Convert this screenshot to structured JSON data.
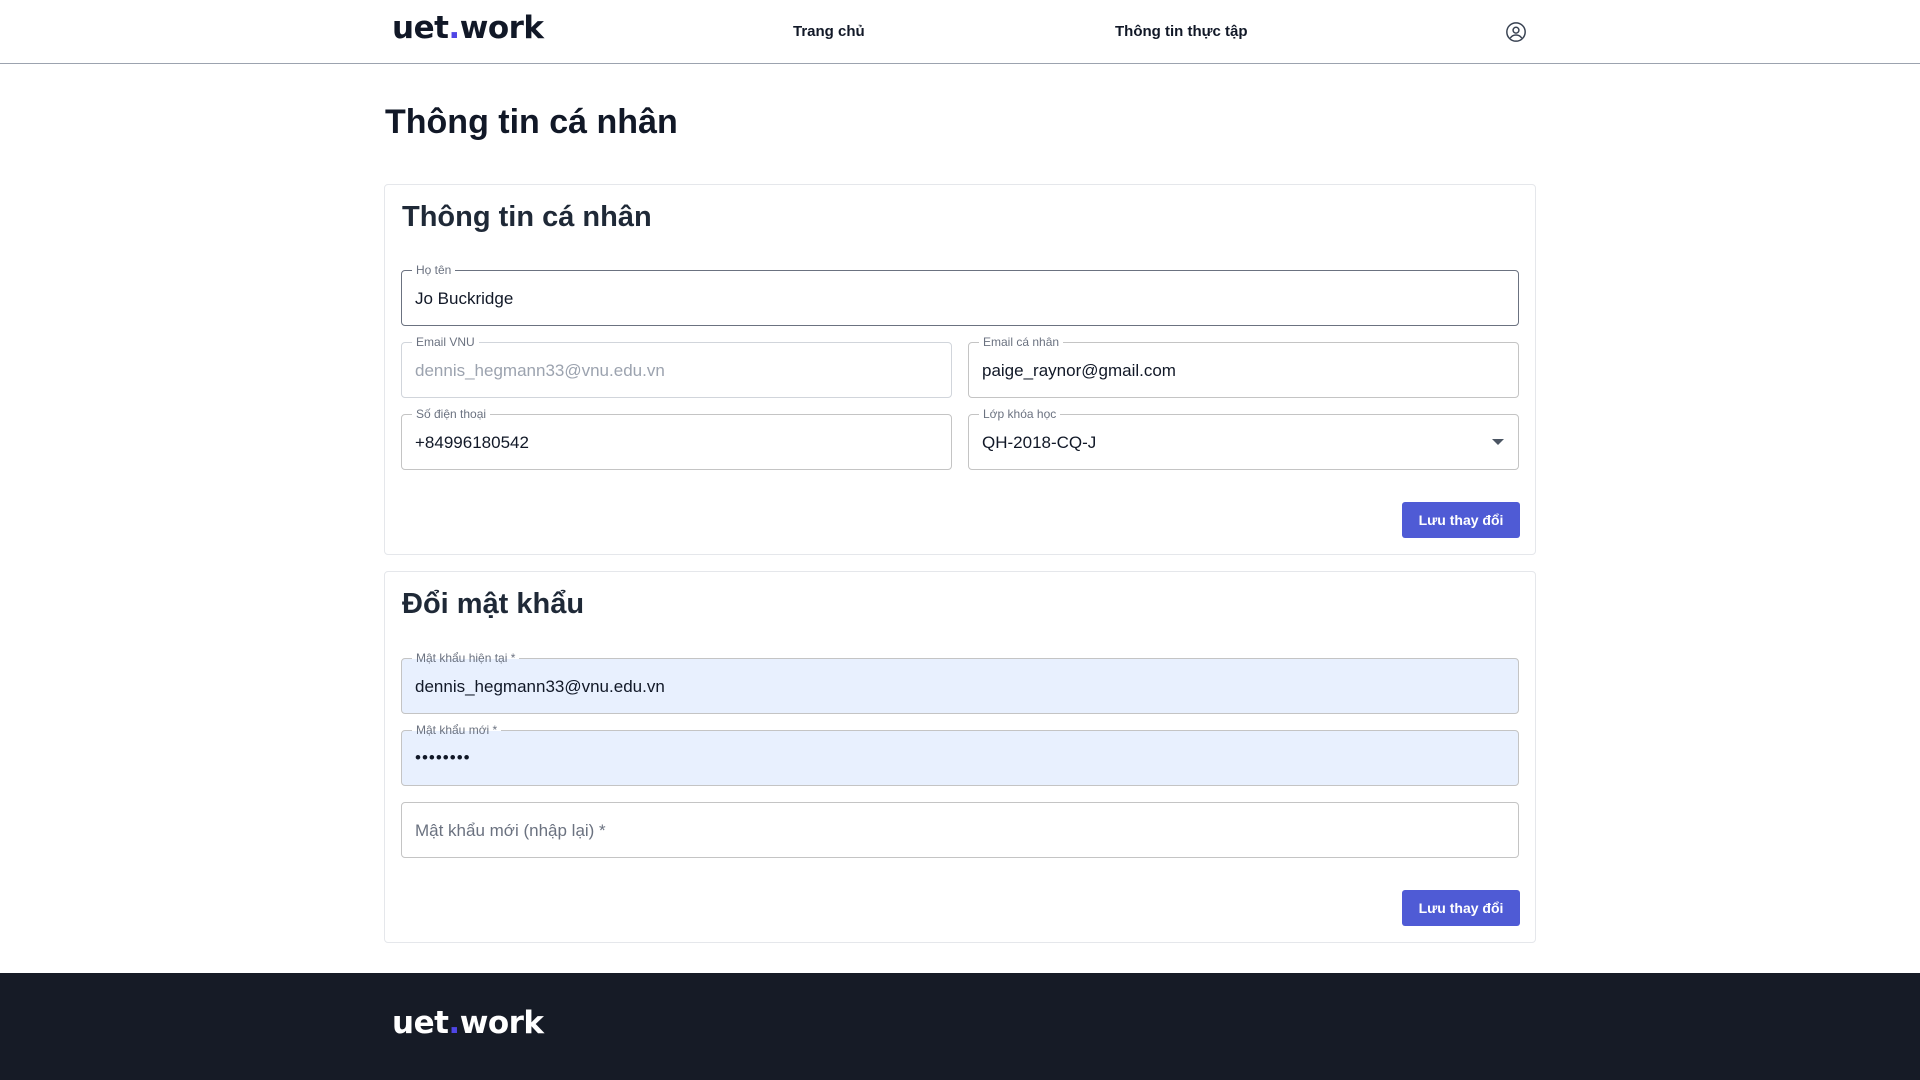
{
  "header": {
    "logo_prefix": "uet",
    "logo_dot": ".",
    "logo_suffix": "work",
    "nav": {
      "home": "Trang chủ",
      "internship": "Thông tin thực tập"
    },
    "user_icon": "user-circle-icon"
  },
  "page": {
    "title": "Thông tin cá nhân"
  },
  "profile_card": {
    "title": "Thông tin cá nhân",
    "full_name": {
      "label": "Họ tên",
      "value": "Jo Buckridge"
    },
    "vnu_email": {
      "label": "Email VNU",
      "value": "dennis_hegmann33@vnu.edu.vn"
    },
    "personal_email": {
      "label": "Email cá nhân",
      "value": "paige_raynor@gmail.com"
    },
    "phone": {
      "label": "Số điện thoại",
      "value": "+84996180542"
    },
    "class": {
      "label": "Lớp khóa học",
      "value": "QH-2018-CQ-J"
    },
    "save_label": "Lưu thay đổi"
  },
  "password_card": {
    "title": "Đổi mật khẩu",
    "current_password": {
      "label": "Mật khẩu hiện tại *",
      "value": "dennis_hegmann33@vnu.edu.vn"
    },
    "new_password": {
      "label": "Mật khẩu mới *",
      "value": "••••••••"
    },
    "confirm_password": {
      "placeholder": "Mật khẩu mới (nhập lại) *"
    },
    "save_label": "Lưu thay đổi"
  },
  "footer": {
    "logo_prefix": "uet",
    "logo_dot": ".",
    "logo_suffix": "work"
  },
  "colors": {
    "accent": "#4f5bd5",
    "logo_dot": "#4f46e5",
    "footer_bg": "#161b26",
    "autofill_bg": "#e8f0fe"
  }
}
